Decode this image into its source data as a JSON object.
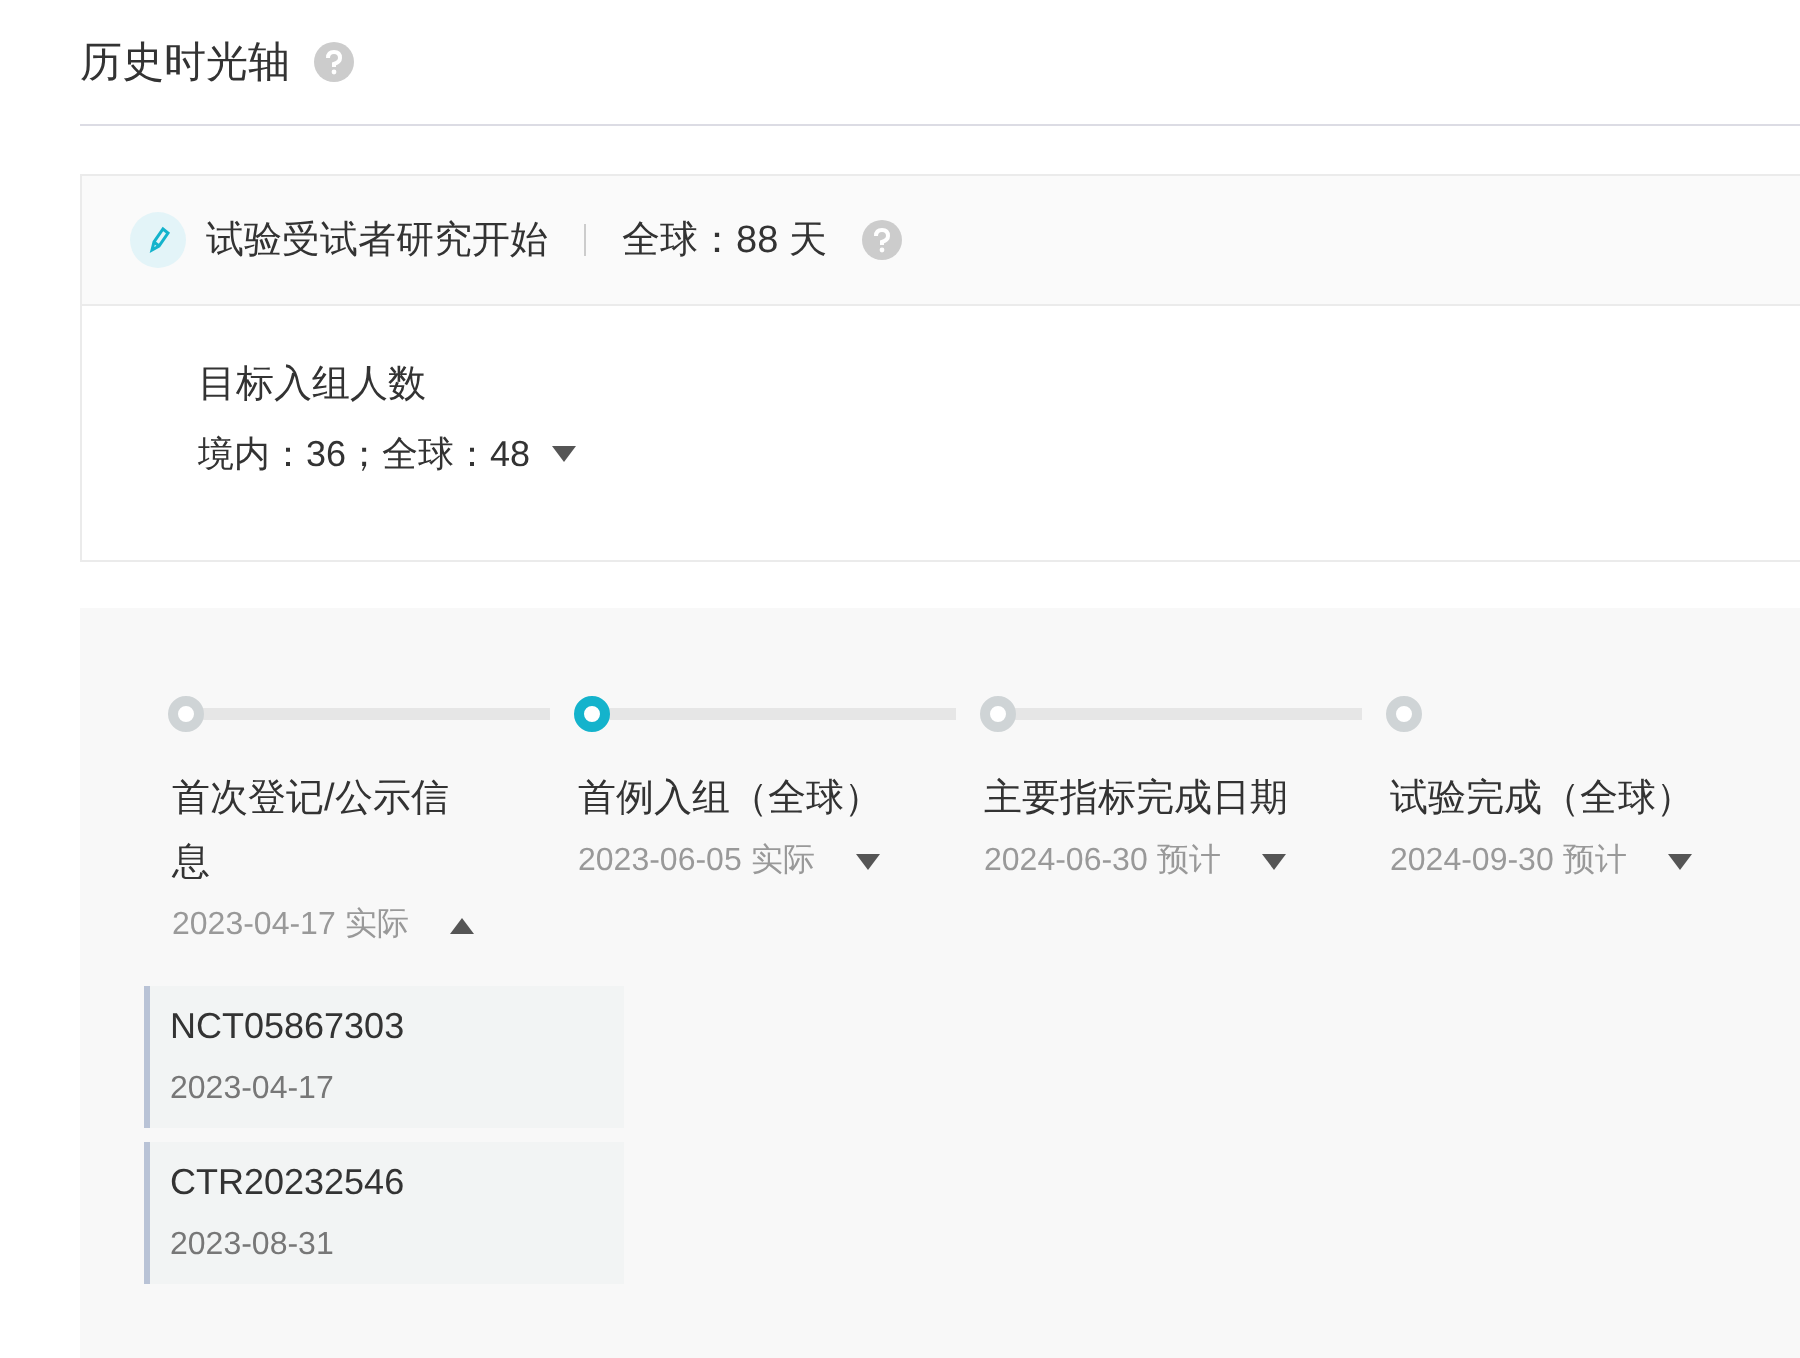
{
  "section": {
    "title": "历史时光轴"
  },
  "milestone": {
    "name": "试验受试者研究开始",
    "summary": "全球：88 天"
  },
  "enrollment": {
    "label": "目标入组人数",
    "value": "境内：36；全球：48",
    "expanded": false
  },
  "steps": [
    {
      "label": "首次登记/公示信息",
      "date": "2023-04-17 实际",
      "current": false,
      "expanded": true,
      "records": [
        {
          "id": "NCT05867303",
          "date": "2023-04-17"
        },
        {
          "id": "CTR20232546",
          "date": "2023-08-31"
        }
      ]
    },
    {
      "label": "首例入组（全球）",
      "date": "2023-06-05 实际",
      "current": true,
      "expanded": false
    },
    {
      "label": "主要指标完成日期",
      "date": "2024-06-30 预计",
      "current": false,
      "expanded": false
    },
    {
      "label": "试验完成（全球）",
      "date": "2024-09-30 预计",
      "current": false,
      "expanded": false
    }
  ]
}
